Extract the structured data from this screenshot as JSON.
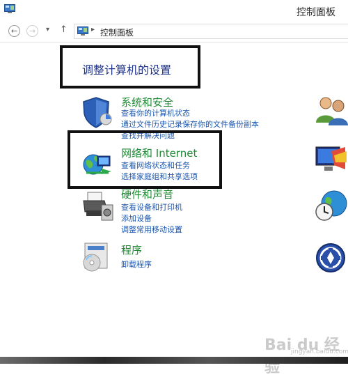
{
  "window": {
    "title": "控制面板"
  },
  "nav": {
    "back": "←",
    "forward": "→",
    "dropdown": "▾",
    "up": "↑",
    "separator": "▸",
    "address": "控制面板"
  },
  "heading": "调整计算机的设置",
  "categories": [
    {
      "title": "系统和安全",
      "icon": "shield-icon",
      "links": [
        "查看你的计算机状态",
        "通过文件历史记录保存你的文件备份副本",
        "查找并解决问题"
      ]
    },
    {
      "title": "网络和 Internet",
      "icon": "network-globe-icon",
      "links": [
        "查看网络状态和任务",
        "选择家庭组和共享选项"
      ]
    },
    {
      "title": "硬件和声音",
      "icon": "printer-icon",
      "links": [
        "查看设备和打印机",
        "添加设备",
        "调整常用移动设置"
      ]
    },
    {
      "title": "程序",
      "icon": "programs-icon",
      "links": [
        "卸载程序"
      ]
    }
  ],
  "right_icons": [
    "user-accounts-icon",
    "appearance-icon",
    "clock-globe-icon",
    "ease-of-access-icon"
  ],
  "watermark": {
    "text": "Bai du 经验",
    "sub": "jingyan.baidu.com"
  },
  "colors": {
    "heading": "#1e3287",
    "category_title": "#1f8a34",
    "link": "#1a56b0"
  }
}
